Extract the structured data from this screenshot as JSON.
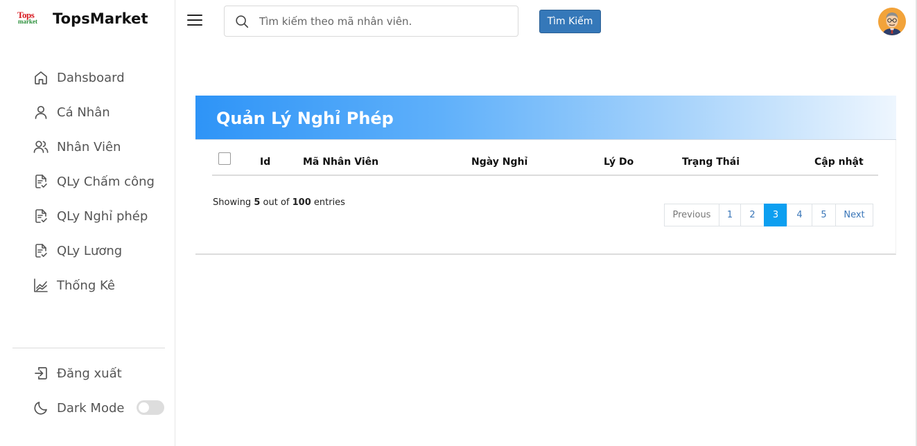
{
  "brand": {
    "logo_top": "Tops",
    "logo_bottom": "market",
    "name": "TopsMarket"
  },
  "sidebar": {
    "items": [
      {
        "label": "Dahsboard",
        "icon": "home-icon"
      },
      {
        "label": "Cá Nhân",
        "icon": "user-icon"
      },
      {
        "label": "Nhân Viên",
        "icon": "users-icon"
      },
      {
        "label": "QLy Chấm công",
        "icon": "clipboard-check-icon"
      },
      {
        "label": "QLy Nghỉ phép",
        "icon": "clipboard-check-icon"
      },
      {
        "label": "QLy Lương",
        "icon": "clipboard-check-icon"
      },
      {
        "label": "Thống Kê",
        "icon": "chart-line-icon"
      }
    ],
    "logout_label": "Đăng xuất",
    "dark_mode_label": "Dark Mode",
    "dark_mode_on": false
  },
  "topbar": {
    "search_placeholder": "Tìm kiếm theo mã nhân viên.",
    "search_button": "Tìm Kiếm"
  },
  "card": {
    "title": "Quản Lý Nghỉ Phép",
    "columns": [
      "Id",
      "Mã Nhân Viên",
      "Ngày Nghỉ",
      "Lý Do",
      "Trạng Thái",
      "Cập nhật"
    ],
    "showing_prefix": "Showing",
    "showing_count": "5",
    "showing_mid": "out of",
    "showing_total": "100",
    "showing_suffix": "entries",
    "pagination": {
      "previous": "Previous",
      "pages": [
        "1",
        "2",
        "3",
        "4",
        "5"
      ],
      "active": "3",
      "next": "Next"
    }
  },
  "colors": {
    "accent": "#3578b9",
    "active_page": "#0d9ff0",
    "header_gradient_start": "#2e94f7"
  }
}
